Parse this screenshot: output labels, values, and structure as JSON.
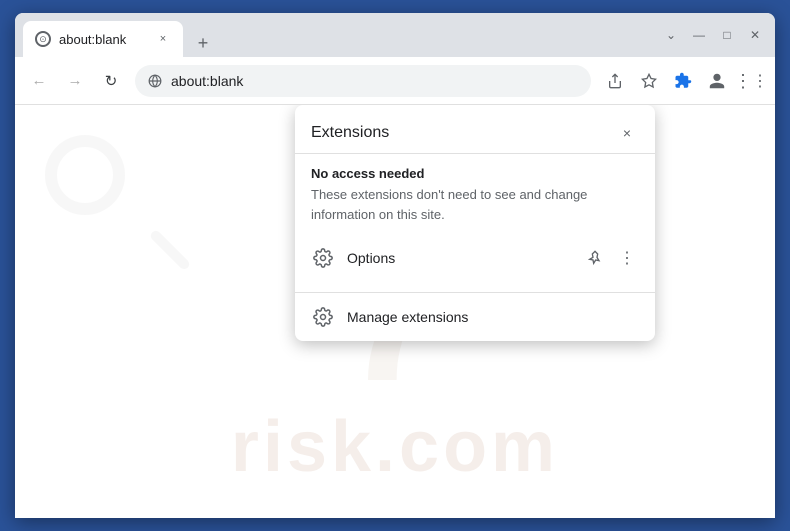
{
  "window": {
    "title": "about:blank",
    "tab_title": "about:blank",
    "tab_close": "×",
    "new_tab": "+",
    "controls": {
      "minimize": "—",
      "maximize": "□",
      "close": "✕",
      "collapse": "⌄"
    }
  },
  "navbar": {
    "back": "←",
    "forward": "→",
    "refresh": "↻",
    "address": "about:blank",
    "address_placeholder": "about:blank",
    "share_icon": "share",
    "bookmark_icon": "★",
    "extensions_icon": "🧩",
    "profile_icon": "👤",
    "more_icon": "⋮"
  },
  "popup": {
    "title": "Extensions",
    "close": "×",
    "section_title": "No access needed",
    "section_desc": "These extensions don't need to see and change information on this site.",
    "options_label": "Options",
    "manage_label": "Manage extensions",
    "pin_icon": "📌",
    "more_icon": "⋮"
  },
  "watermark": {
    "text": "risk.com"
  },
  "colors": {
    "brand_blue": "#2a5298",
    "tab_bg": "#ffffff",
    "chrome_bg": "#dee1e6",
    "popup_bg": "#ffffff",
    "text_primary": "#202124",
    "text_secondary": "#5f6368"
  }
}
